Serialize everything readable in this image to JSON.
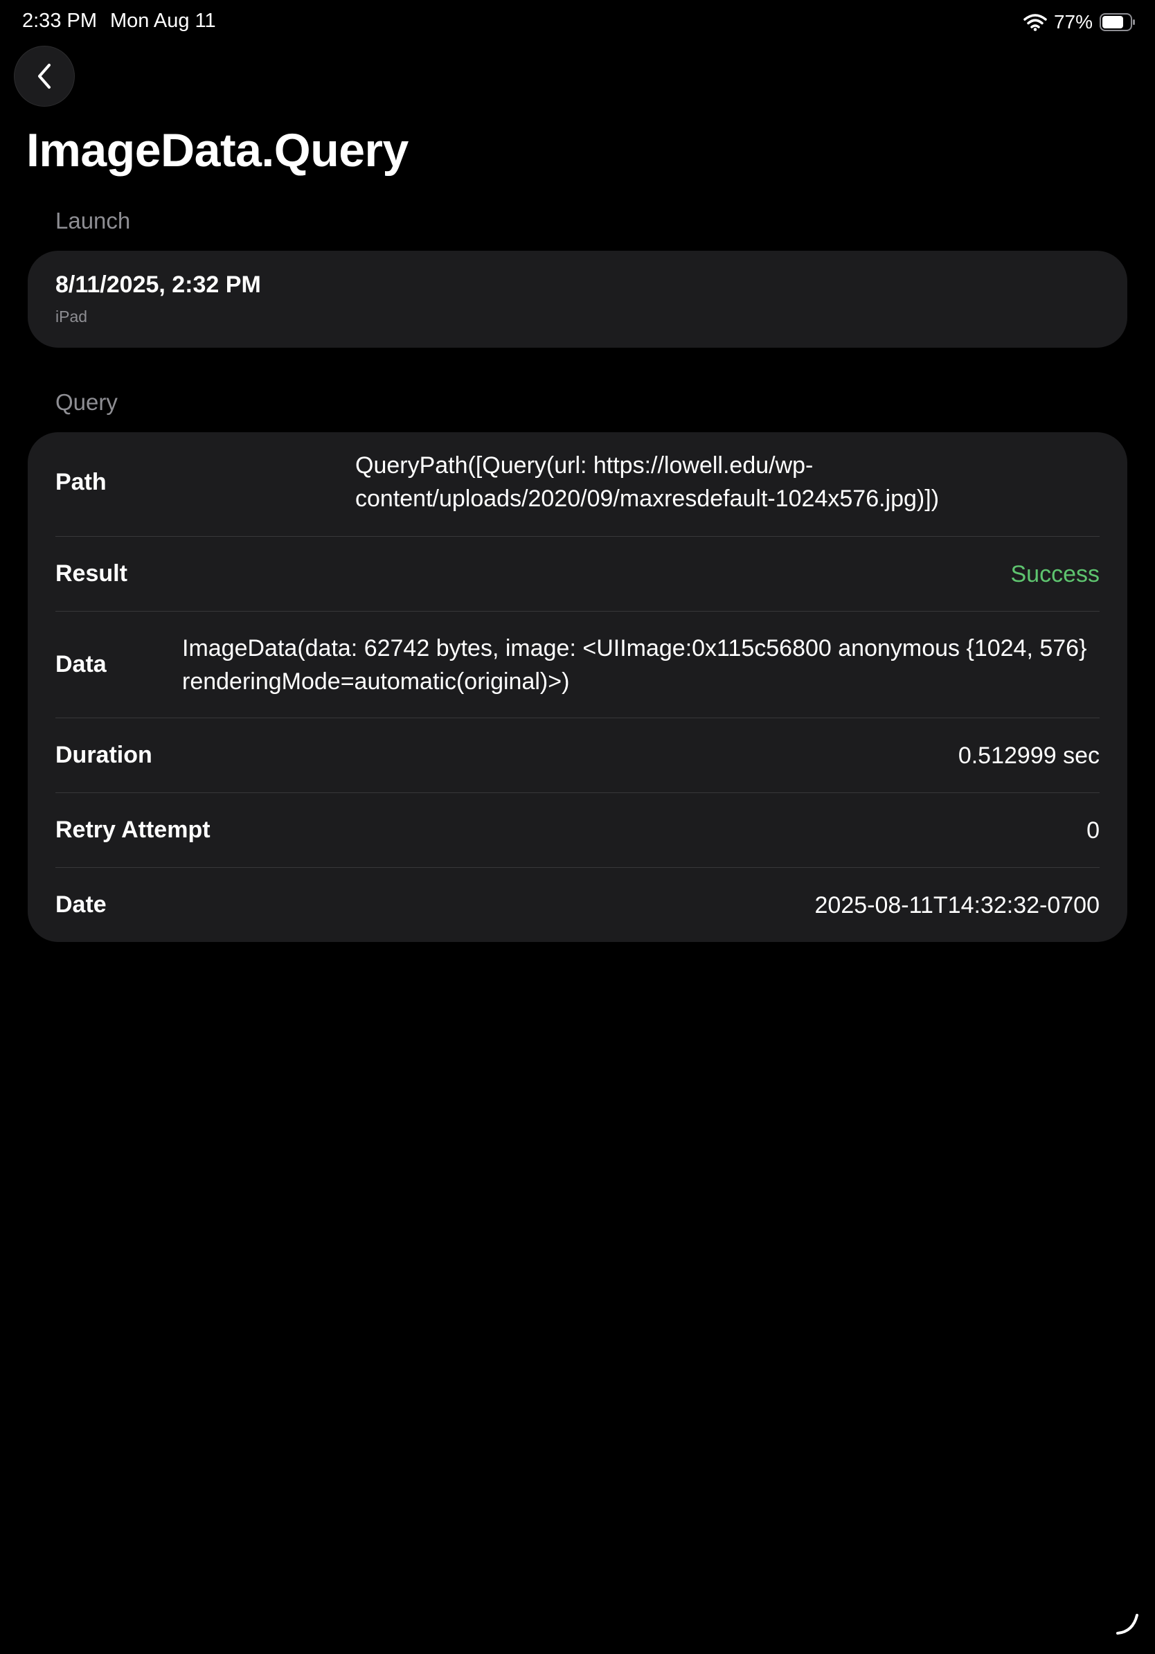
{
  "status_bar": {
    "time": "2:33 PM",
    "date": "Mon Aug 11",
    "battery_percent": "77%",
    "battery_level": 0.77
  },
  "nav": {
    "back_icon": "chevron-left-icon"
  },
  "title": "ImageData.Query",
  "launch": {
    "section_title": "Launch",
    "date": "8/11/2025, 2:32 PM",
    "device": "iPad"
  },
  "query": {
    "section_title": "Query",
    "rows": [
      {
        "label": "Path",
        "value": "QueryPath([Query(url: https://lowell.edu/wp-content/uploads/2020/09/maxresdefault-1024x576.jpg)])"
      },
      {
        "label": "Result",
        "value": "Success"
      },
      {
        "label": "Data",
        "value": "ImageData(data: 62742 bytes, image: <UIImage:0x115c56800 anonymous {1024, 576} renderingMode=automatic(original)>)"
      },
      {
        "label": "Duration",
        "value": "0.512999 sec"
      },
      {
        "label": "Retry Attempt",
        "value": "0"
      },
      {
        "label": "Date",
        "value": "2025-08-11T14:32:32-0700"
      }
    ]
  },
  "colors": {
    "background": "#000000",
    "card": "#1c1c1e",
    "secondary_text": "#8e8e93",
    "success": "#5ec46f",
    "separator": "#38383a"
  }
}
